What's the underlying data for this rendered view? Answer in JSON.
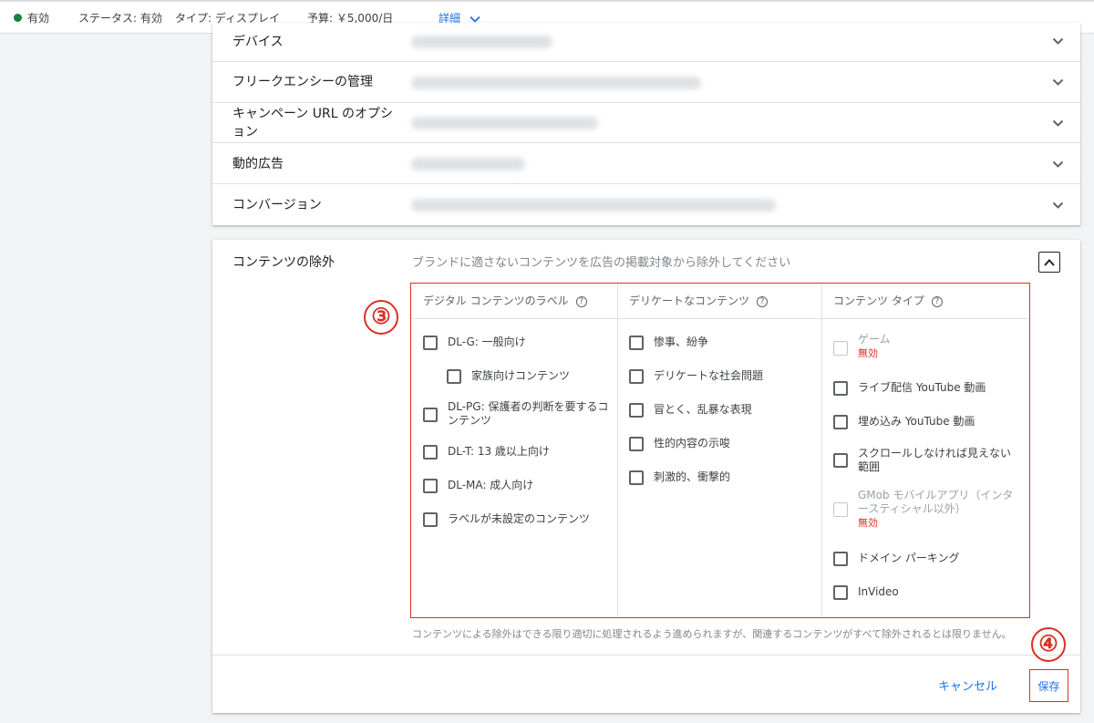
{
  "topbar": {
    "status_short": "有効",
    "status_full": "ステータス: 有効",
    "type": "タイプ: ディスプレイ",
    "budget": "予算: ￥5,000/日",
    "details_link": "詳細"
  },
  "settings_rows": [
    {
      "label": "デバイス"
    },
    {
      "label": "フリークエンシーの管理"
    },
    {
      "label": "キャンペーン URL のオプション"
    },
    {
      "label": "動的広告"
    },
    {
      "label": "コンバージョン"
    }
  ],
  "content_exclusion": {
    "title": "コンテンツの除外",
    "description": "ブランドに適さないコンテンツを広告の掲載対象から除外してください",
    "annotation_step": "③",
    "columns": [
      {
        "header": "デジタル コンテンツのラベル",
        "options": [
          {
            "label": "DL-G: 一般向け"
          },
          {
            "label": "家族向けコンテンツ"
          },
          {
            "label": "DL-PG: 保護者の判断を要するコンテンツ"
          },
          {
            "label": "DL-T: 13 歳以上向け"
          },
          {
            "label": "DL-MA: 成人向け"
          },
          {
            "label": "ラベルが未設定のコンテンツ"
          }
        ]
      },
      {
        "header": "デリケートなコンテンツ",
        "options": [
          {
            "label": "惨事、紛争"
          },
          {
            "label": "デリケートな社会問題"
          },
          {
            "label": "冒とく、乱暴な表現"
          },
          {
            "label": "性的内容の示唆"
          },
          {
            "label": "刺激的、衝撃的"
          }
        ]
      },
      {
        "header": "コンテンツ タイプ",
        "options": [
          {
            "label": "ゲーム",
            "note": "無効"
          },
          {
            "label": "ライブ配信 YouTube 動画"
          },
          {
            "label": "埋め込み YouTube 動画"
          },
          {
            "label": "スクロールしなければ見えない範囲"
          },
          {
            "label": "GMob モバイルアプリ（インタースティシャル以外）",
            "note": "無効"
          },
          {
            "label": "ドメイン パーキング"
          },
          {
            "label": "InVideo"
          }
        ]
      }
    ],
    "footnote": "コンテンツによる除外はできる限り適切に処理されるよう進められますが、関連するコンテンツがすべて除外されるとは限りません。"
  },
  "actions": {
    "annotation_step": "④",
    "cancel_label": "キャンセル",
    "save_label": "保存"
  },
  "colors": {
    "accent": "#1a73e8",
    "annotation": "#d93025",
    "status_green": "#188038"
  }
}
